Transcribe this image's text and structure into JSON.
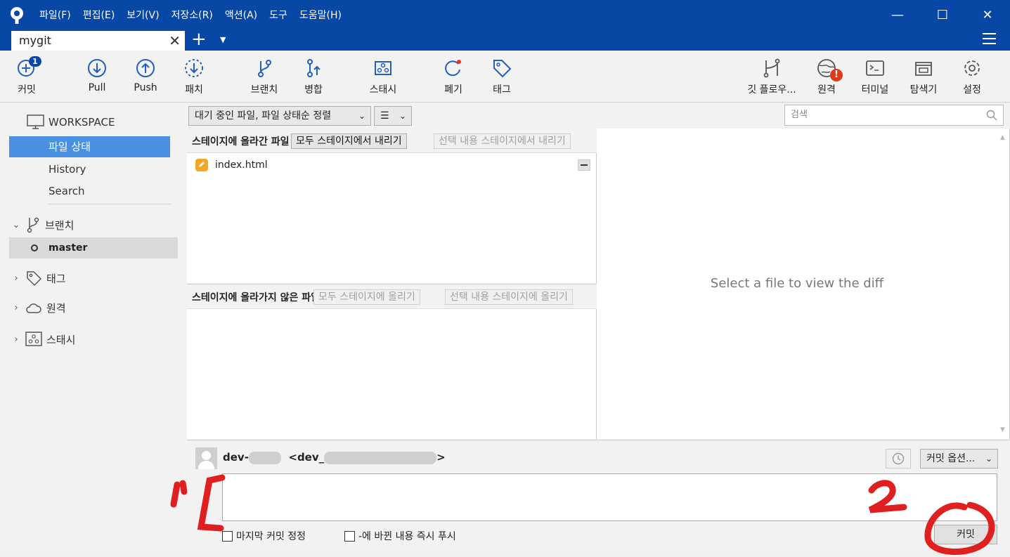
{
  "window": {
    "menu": [
      "파일(F)",
      "편집(E)",
      "보기(V)",
      "저장소(R)",
      "액션(A)",
      "도구",
      "도움말(H)"
    ],
    "controls": {
      "minimize": "—",
      "maximize": "☐",
      "close": "✕"
    },
    "tab": {
      "label": "mygit",
      "close": "✕"
    },
    "tab_add": "+",
    "tab_dropdown": "▼",
    "colors": {
      "titlebar": "#0747a6",
      "selection": "#4a90e2",
      "annotation": "#e02020"
    }
  },
  "toolbar": {
    "commit": {
      "label": "커밋",
      "badge": "1",
      "icon": "commit-plus-icon"
    },
    "pull": {
      "label": "Pull",
      "icon": "pull-icon"
    },
    "push": {
      "label": "Push",
      "icon": "push-icon"
    },
    "patch": {
      "label": "패치",
      "icon": "patch-icon"
    },
    "branch": {
      "label": "브랜치",
      "icon": "branch-icon"
    },
    "merge": {
      "label": "병합",
      "icon": "merge-icon"
    },
    "stash": {
      "label": "스태시",
      "icon": "stash-icon"
    },
    "discard": {
      "label": "폐기",
      "icon": "discard-icon"
    },
    "tag": {
      "label": "태그",
      "icon": "tag-icon"
    },
    "gitflow": {
      "label": "깃 플로우...",
      "icon": "gitflow-icon"
    },
    "remote": {
      "label": "원격",
      "icon": "globe-icon",
      "warning": "!"
    },
    "terminal": {
      "label": "터미널",
      "icon": "terminal-icon"
    },
    "explorer": {
      "label": "탐색기",
      "icon": "explorer-icon"
    },
    "settings": {
      "label": "설정",
      "icon": "gear-icon"
    }
  },
  "sidebar": {
    "workspace": "WORKSPACE",
    "items": [
      {
        "label": "파일 상태",
        "active": true
      },
      {
        "label": "History",
        "active": false
      },
      {
        "label": "Search",
        "active": false
      }
    ],
    "branches": {
      "label": "브랜치",
      "expanded": true,
      "items": [
        "master"
      ]
    },
    "tags": {
      "label": "태그"
    },
    "remotes": {
      "label": "원격"
    },
    "stashes": {
      "label": "스태시"
    }
  },
  "filter": {
    "sort_select": "대기 중인 파일, 파일 상태순 정렬",
    "view_select": "☰",
    "search_placeholder": "검색"
  },
  "staged": {
    "title": "스테이지에 올라간 파일",
    "unstage_all": "모두 스테이지에서 내리기",
    "unstage_selected": "선택 내용 스테이지에서 내리기",
    "files": [
      {
        "name": "index.html",
        "status": "modified"
      }
    ]
  },
  "unstaged": {
    "title": "스테이지에 올라가지 않은 파일",
    "stage_all": "모두 스테이지에 올리기",
    "stage_selected": "선택 내용 스테이지에 올리기"
  },
  "diff": {
    "placeholder": "Select a file to view the diff"
  },
  "commit": {
    "author_name": "dev-",
    "author_email_prefix": "<dev_",
    "author_email_suffix": ">",
    "options": "커밋 옵션...",
    "amend_label": "마지막 커밋 정정",
    "push_label": "-에 바뀐 내용 즉시 푸시",
    "amend_checked": false,
    "push_checked": false,
    "commit_button": "커밋",
    "message": ""
  },
  "annotations": {
    "marker_1": "1",
    "marker_2": "2"
  }
}
